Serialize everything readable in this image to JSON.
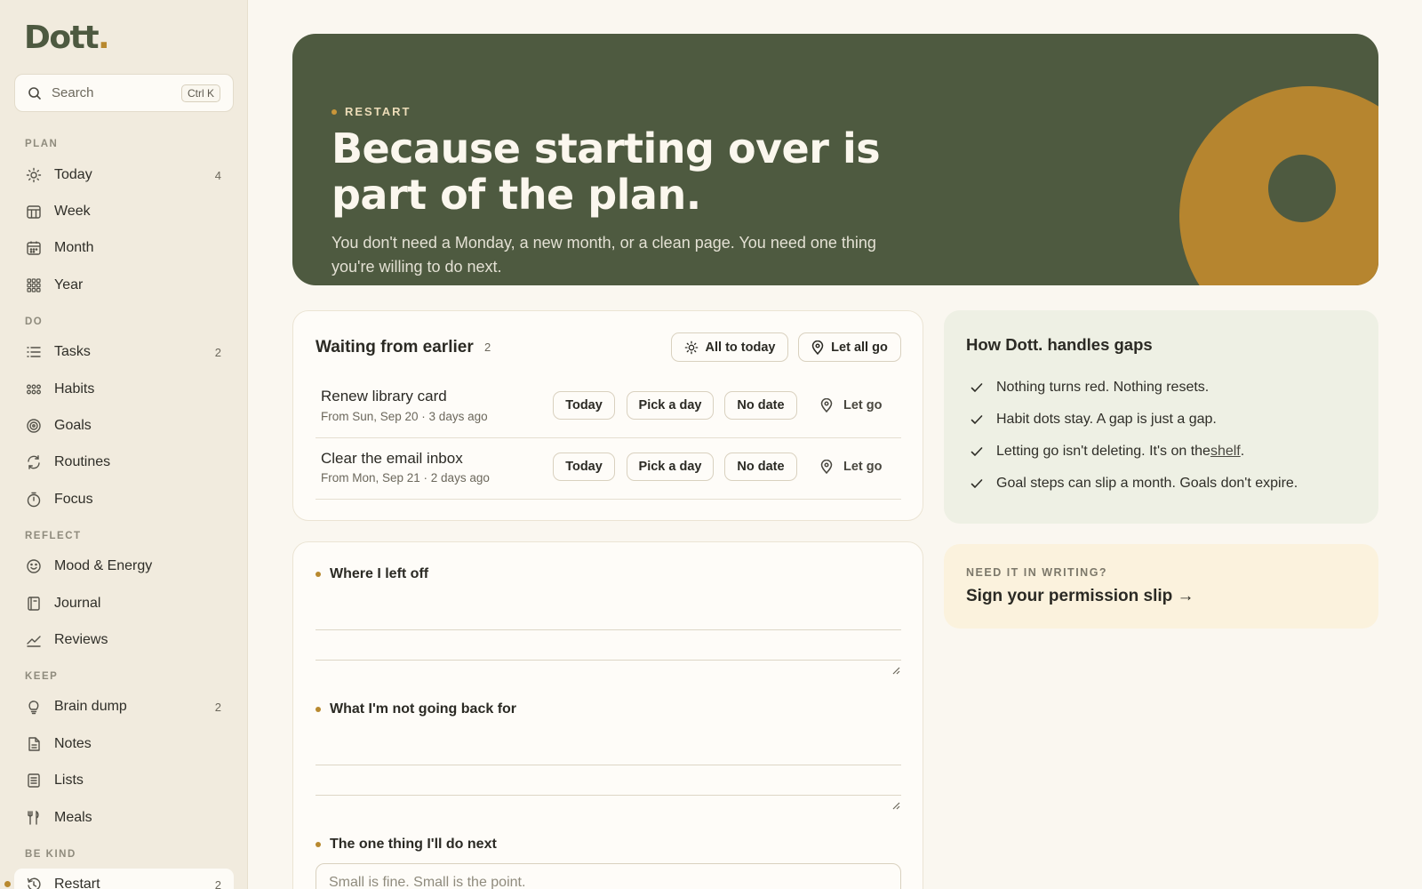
{
  "app": {
    "logo_text": "Dott",
    "logo_dot": "."
  },
  "search": {
    "placeholder": "Search",
    "shortcut": "Ctrl K"
  },
  "sidebar": {
    "sections": [
      {
        "label": "PLAN"
      },
      {
        "label": "DO"
      },
      {
        "label": "REFLECT"
      },
      {
        "label": "KEEP"
      },
      {
        "label": "BE KIND"
      }
    ],
    "items": [
      {
        "label": "Today",
        "count": "4",
        "icon": "sun-icon"
      },
      {
        "label": "Week",
        "count": "",
        "icon": "calendar-week-icon"
      },
      {
        "label": "Month",
        "count": "",
        "icon": "calendar-month-icon"
      },
      {
        "label": "Year",
        "count": "",
        "icon": "grid-year-icon"
      },
      {
        "label": "Tasks",
        "count": "2",
        "icon": "list-icon"
      },
      {
        "label": "Habits",
        "count": "",
        "icon": "dots-icon"
      },
      {
        "label": "Goals",
        "count": "",
        "icon": "target-icon"
      },
      {
        "label": "Routines",
        "count": "",
        "icon": "refresh-icon"
      },
      {
        "label": "Focus",
        "count": "",
        "icon": "timer-icon"
      },
      {
        "label": "Mood & Energy",
        "count": "",
        "icon": "smile-icon"
      },
      {
        "label": "Journal",
        "count": "",
        "icon": "book-icon"
      },
      {
        "label": "Reviews",
        "count": "",
        "icon": "trend-icon"
      },
      {
        "label": "Brain dump",
        "count": "2",
        "icon": "bulb-icon"
      },
      {
        "label": "Notes",
        "count": "",
        "icon": "note-icon"
      },
      {
        "label": "Lists",
        "count": "",
        "icon": "lines-icon"
      },
      {
        "label": "Meals",
        "count": "",
        "icon": "fork-knife-icon"
      },
      {
        "label": "Restart",
        "count": "2",
        "icon": "restart-icon",
        "active": true
      }
    ]
  },
  "hero": {
    "eyebrow": "RESTART",
    "title": "Because starting over is part of the plan.",
    "body": "You don't need a Monday, a new month, or a clean page. You need one thing you're willing to do next."
  },
  "waiting": {
    "title": "Waiting from earlier",
    "count": "2",
    "all_today": "All to today",
    "let_all_go": "Let all go",
    "tasks": [
      {
        "title": "Renew library card",
        "sub": "From Sun, Sep 20 · 3 days ago"
      },
      {
        "title": "Clear the email inbox",
        "sub": "From Mon, Sep 21 · 2 days ago"
      }
    ],
    "actions": {
      "today": "Today",
      "pick": "Pick a day",
      "nodate": "No date",
      "letgo": "Let go"
    }
  },
  "notes": {
    "fields": [
      {
        "label": "Where I left off"
      },
      {
        "label": "What I'm not going back for"
      },
      {
        "label": "The one thing I'll do next",
        "placeholder": "Small is fine. Small is the point."
      }
    ]
  },
  "gaps": {
    "title": "How Dott. handles gaps",
    "items": [
      "Nothing turns red. Nothing resets.",
      "Habit dots stay. A gap is just a gap.",
      "Goal steps can slip a month. Goals don't expire."
    ],
    "shelf_prefix": "Letting go isn't deleting. It's on the ",
    "shelf_link": "shelf",
    "shelf_suffix": "."
  },
  "slip": {
    "eyebrow": "NEED IT IN WRITING?",
    "title": "Sign your permission slip →"
  },
  "colors": {
    "accent": "#b8892f",
    "hero": "#4e5a40",
    "background": "#faf7f0"
  }
}
